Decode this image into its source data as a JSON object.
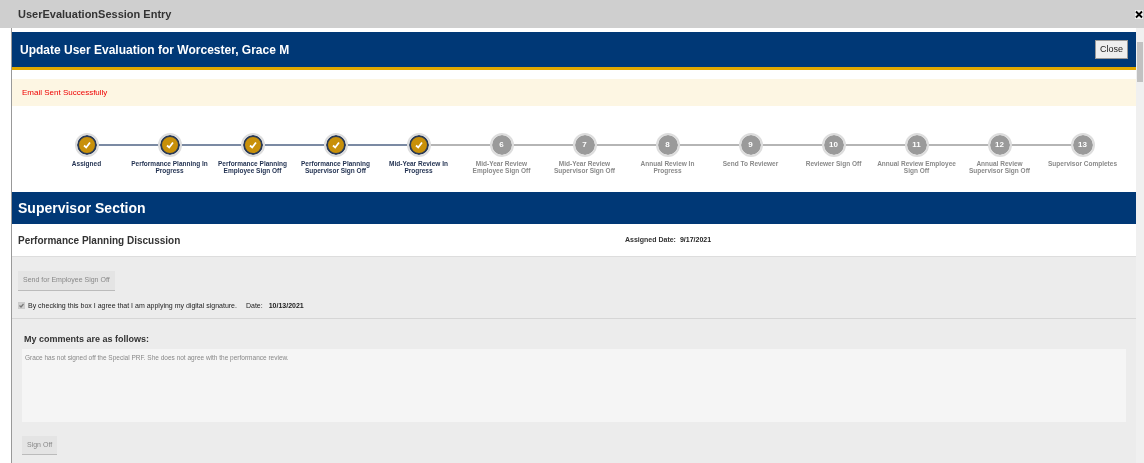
{
  "window": {
    "title": "UserEvaluationSession Entry"
  },
  "header": {
    "title": "Update User Evaluation for Worcester, Grace M",
    "close_button": "Close"
  },
  "notice": "Email Sent Successfully",
  "steps": [
    {
      "label": "Assigned",
      "completed": true
    },
    {
      "label": "Performance Planning In Progress",
      "completed": true
    },
    {
      "label": "Performance Planning Employee Sign Off",
      "completed": true
    },
    {
      "label": "Performance Planning Supervisor Sign Off",
      "completed": true
    },
    {
      "label": "Mid-Year Review In Progress",
      "completed": true
    },
    {
      "label": "Mid-Year Review Employee Sign Off",
      "number": "6",
      "completed": false
    },
    {
      "label": "Mid-Year Review Supervisor Sign Off",
      "number": "7",
      "completed": false
    },
    {
      "label": "Annual Review In Progress",
      "number": "8",
      "completed": false
    },
    {
      "label": "Send To Reviewer",
      "number": "9",
      "completed": false
    },
    {
      "label": "Reviewer Sign Off",
      "number": "10",
      "completed": false
    },
    {
      "label": "Annual Review Employee Sign Off",
      "number": "11",
      "completed": false
    },
    {
      "label": "Annual Review Supervisor Sign Off",
      "number": "12",
      "completed": false
    },
    {
      "label": "Supervisor Completes",
      "number": "13",
      "completed": false
    }
  ],
  "section": {
    "title": "Supervisor Section",
    "subtitle": "Performance Planning Discussion",
    "assigned_label": "Assigned Date:",
    "assigned_date": "9/17/2021",
    "send_button": {
      "label": "Send for Employee Sign Off",
      "disabled": true
    },
    "signature": {
      "label": "By checking this box I agree that I am applying my digital signature.",
      "checked": true,
      "date_label": "Date:",
      "date": "10/13/2021"
    },
    "comments_label": "My comments are as follows:",
    "comments": "Grace has not signed off the Special PRF. She does not agree with the performance review.",
    "sign_off_button": {
      "label": "Sign Off",
      "disabled": true
    }
  }
}
